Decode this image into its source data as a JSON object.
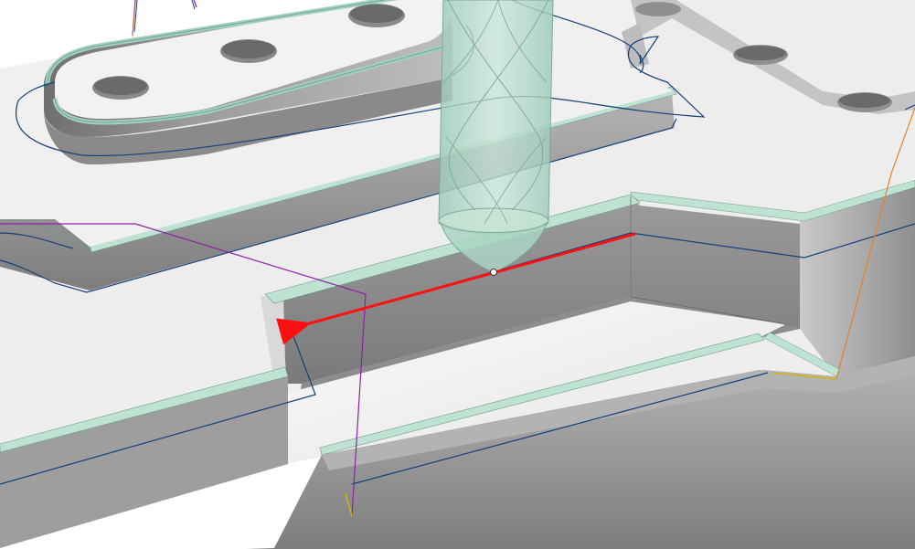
{
  "viewport": {
    "kind": "3d-cam-toolpath-simulation",
    "background_color": "#ffffff"
  },
  "colors": {
    "top_face": "#ececec",
    "top_face_light": "#f4f4f4",
    "wall_dark": "#7e7e7e",
    "wall_mid": "#a3a3a3",
    "wall_light": "#c9c9c9",
    "chamfer": "#b9dfcd",
    "chamfer_edge": "#6d9a87",
    "edge": "#4b4b4b",
    "tool_body": "#a9d5c3",
    "tool_outline": "#7ea898",
    "toolpath_blue": "#13417a",
    "toolpath_purple": "#8e21a6",
    "toolpath_orange": "#e1822f",
    "toolpath_yellow": "#d9b400",
    "current_move_red": "#ff1010",
    "tool_tip_marker": "#ffffff"
  },
  "scene": {
    "part": "machined-plate-with-pocket-and-slotted-boss",
    "boss_holes": 3,
    "corner_holes": 2,
    "tool": "ball-end-mill",
    "current_move": "linear-cut",
    "current_move_direction": "left"
  }
}
